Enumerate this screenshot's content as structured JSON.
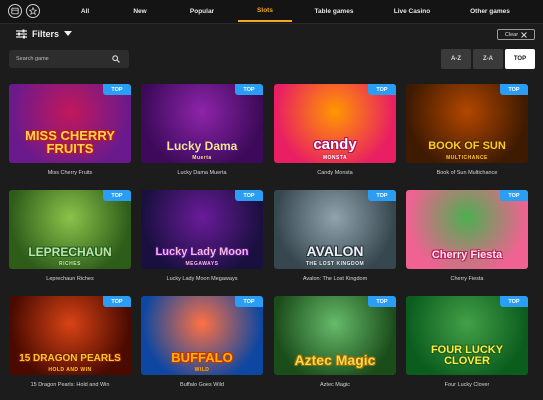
{
  "nav": {
    "tabs": [
      {
        "label": "All"
      },
      {
        "label": "New"
      },
      {
        "label": "Popular"
      },
      {
        "label": "Slots",
        "active": true
      },
      {
        "label": "Table games"
      },
      {
        "label": "Live Casino"
      },
      {
        "label": "Other games"
      }
    ],
    "icons": [
      "history-icon",
      "star-icon"
    ]
  },
  "filters": {
    "label": "Filters",
    "clear_label": "Clear"
  },
  "search": {
    "placeholder": "Search game"
  },
  "sort": {
    "options": [
      {
        "label": "A-Z",
        "selected": false
      },
      {
        "label": "Z-A",
        "selected": false
      },
      {
        "label": "TOP",
        "selected": true
      }
    ]
  },
  "badge": "TOP",
  "games": [
    {
      "name": "Miss Cherry Fruits",
      "art_text": "MISS CHERRY FRUITS",
      "art_sub": "",
      "bg": [
        "#6a1a8c",
        "#c2185b"
      ],
      "text_color": "#ffd54f",
      "stroke": "#b71c1c"
    },
    {
      "name": "Lucky Dama Muerta",
      "art_text": "Lucky Dama",
      "art_sub": "Muerta",
      "bg": [
        "#3d0a5a",
        "#8e24aa"
      ],
      "text_color": "#ffe082",
      "stroke": "#4a148c"
    },
    {
      "name": "Candy Monsta",
      "art_text": "candy",
      "art_sub": "MONSTA",
      "bg": [
        "#e91e63",
        "#ff9800"
      ],
      "text_color": "#ffffff",
      "stroke": "#ad1457"
    },
    {
      "name": "Book of Sun Multichance",
      "art_text": "BOOK OF SUN",
      "art_sub": "MULTICHANCE",
      "bg": [
        "#3e1a00",
        "#b34700"
      ],
      "text_color": "#ffca28",
      "stroke": "#4e2600"
    },
    {
      "name": "Leprechaun Riches",
      "art_text": "LEPRECHAUN",
      "art_sub": "RICHES",
      "bg": [
        "#2e5d1a",
        "#8bc34a"
      ],
      "text_color": "#c5e1a5",
      "stroke": "#1b5e20"
    },
    {
      "name": "Lucky Lady Moon Megaways",
      "art_text": "Lucky Lady Moon",
      "art_sub": "MEGAWAYS",
      "bg": [
        "#1a1040",
        "#6a1b9a"
      ],
      "text_color": "#f8bbd0",
      "stroke": "#4a148c"
    },
    {
      "name": "Avalon: The Lost Kingdom",
      "art_text": "AVALON",
      "art_sub": "THE LOST KINGDOM",
      "bg": [
        "#37474f",
        "#90a4ae"
      ],
      "text_color": "#eceff1",
      "stroke": "#263238"
    },
    {
      "name": "Cherry Fiesta",
      "art_text": "Cherry Fiesta",
      "art_sub": "",
      "bg": [
        "#f06292",
        "#4caf50"
      ],
      "text_color": "#ffebee",
      "stroke": "#c2185b"
    },
    {
      "name": "15 Dragon Pearls: Hold and Win",
      "art_text": "15 DRAGON PEARLS",
      "art_sub": "HOLD AND WIN",
      "bg": [
        "#4a0a00",
        "#d84315"
      ],
      "text_color": "#ffca28",
      "stroke": "#7f1d00"
    },
    {
      "name": "Buffalo Goes Wild",
      "art_text": "BUFFALO",
      "art_sub": "WILD",
      "bg": [
        "#0d47a1",
        "#ff7043"
      ],
      "text_color": "#ffb300",
      "stroke": "#bf360c"
    },
    {
      "name": "Aztec Magic",
      "art_text": "Aztec Magic",
      "art_sub": "",
      "bg": [
        "#1b4d1b",
        "#66bb6a"
      ],
      "text_color": "#ffd54f",
      "stroke": "#8d6e00"
    },
    {
      "name": "Four Lucky Clover",
      "art_text": "FOUR LUCKY CLOVER",
      "art_sub": "",
      "bg": [
        "#0b5d1e",
        "#43a047"
      ],
      "text_color": "#ffeb3b",
      "stroke": "#1b5e20"
    }
  ],
  "colors": {
    "accent": "#f5a623",
    "badge": "#2a9df4",
    "background": "#1c1c1c"
  }
}
